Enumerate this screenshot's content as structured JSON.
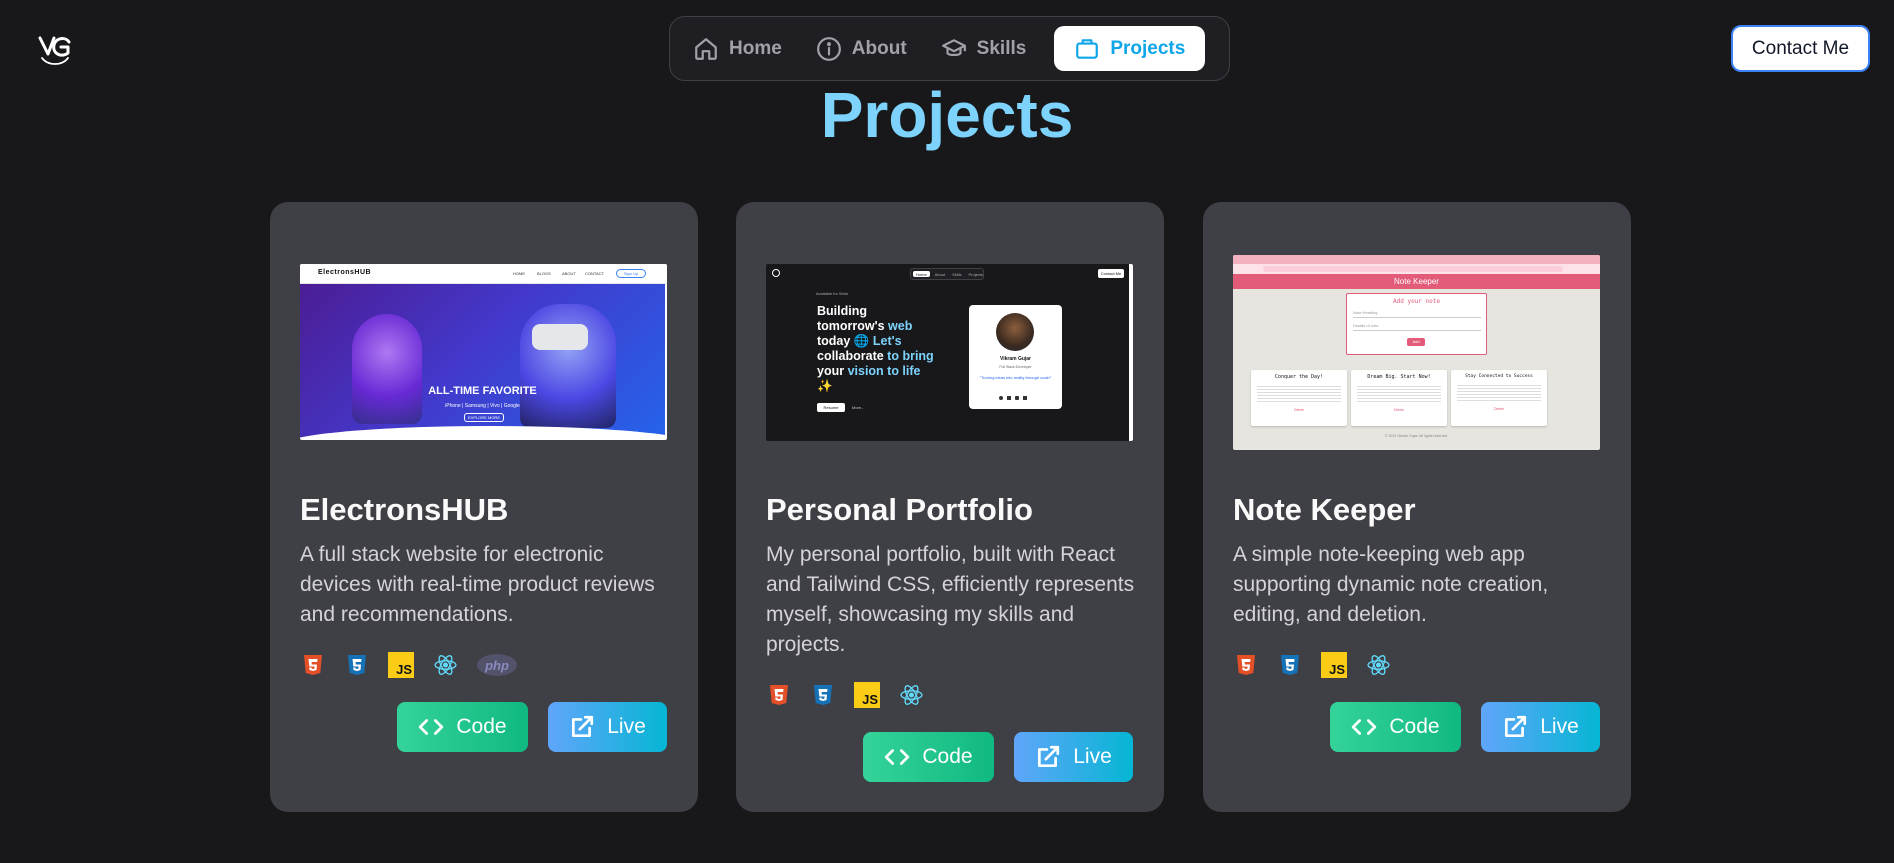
{
  "logo": {
    "alt": "VG logo"
  },
  "nav": {
    "items": [
      {
        "label": "Home",
        "icon": "home-icon",
        "active": false
      },
      {
        "label": "About",
        "icon": "info-icon",
        "active": false
      },
      {
        "label": "Skills",
        "icon": "graduation-cap-icon",
        "active": false
      },
      {
        "label": "Projects",
        "icon": "briefcase-icon",
        "active": true
      }
    ]
  },
  "contact_label": "Contact Me",
  "page_title": "Projects",
  "colors": {
    "background": "#18181b",
    "card": "#3f3f46",
    "accent": "#7dd3fc",
    "active_nav_text": "#0ea5e9"
  },
  "projects": [
    {
      "title": "ElectronsHUB",
      "description": "A full stack website for electronic devices with real-time product reviews and recommendations.",
      "tech": [
        "html5-icon",
        "css3-icon",
        "javascript-icon",
        "react-icon",
        "php-icon"
      ],
      "code_label": "Code",
      "live_label": "Live",
      "preview": {
        "brand": "ElectronsHUB",
        "nav": [
          "HOME",
          "BLOGS",
          "ABOUT",
          "CONTACT"
        ],
        "signup": "Sign Up",
        "headline": "ALL-TIME FAVORITE",
        "subline": "iPhone | Samsung | Vivo | Google",
        "cta": "EXPLORE MORE"
      }
    },
    {
      "title": "Personal Portfolio",
      "description": "My personal portfolio, built with React and Tailwind CSS, efficiently represents myself, showcasing my skills and projects.",
      "tech": [
        "html5-icon",
        "css3-icon",
        "javascript-icon",
        "react-icon"
      ],
      "code_label": "Code",
      "live_label": "Live",
      "preview": {
        "nav": [
          "Home",
          "About",
          "Skills",
          "Projects"
        ],
        "contact": "Contact Me",
        "badge": "Available for Work",
        "hero_line1": "Building",
        "hero_line2a": "tomorrow's ",
        "hero_line2b": "web",
        "hero_line3a": "today 🌐 ",
        "hero_line3b": "Let's",
        "hero_line4a": "collaborate ",
        "hero_line4b": "to bring",
        "hero_line5a": "your ",
        "hero_line5b": "vision to life",
        "hero_line6": "✨",
        "btn1": "Resume",
        "btn2": "More...",
        "profile_name": "Vikram Gujar",
        "profile_role": "Full Stack Developer",
        "profile_quote": "\"Turning ideas into reality through code!\""
      }
    },
    {
      "title": "Note Keeper",
      "description": "A simple note-keeping web app supporting dynamic note creation, editing, and deletion.",
      "tech": [
        "html5-icon",
        "css3-icon",
        "javascript-icon",
        "react-icon"
      ],
      "code_label": "Code",
      "live_label": "Live",
      "preview": {
        "app_title": "Note Keeper",
        "form_title": "Add your note",
        "title_placeholder": "Note Heading",
        "body_placeholder": "Details of note",
        "add_btn": "Add",
        "notes": [
          {
            "title": "Conquer the Day!",
            "delete": "Delete"
          },
          {
            "title": "Dream Big. Start Now!",
            "delete": "Delete"
          },
          {
            "title": "Stay Connected to Success",
            "delete": "Delete"
          }
        ],
        "footer": "© 2024 Vikram Gujar. All rights reserved."
      }
    }
  ]
}
